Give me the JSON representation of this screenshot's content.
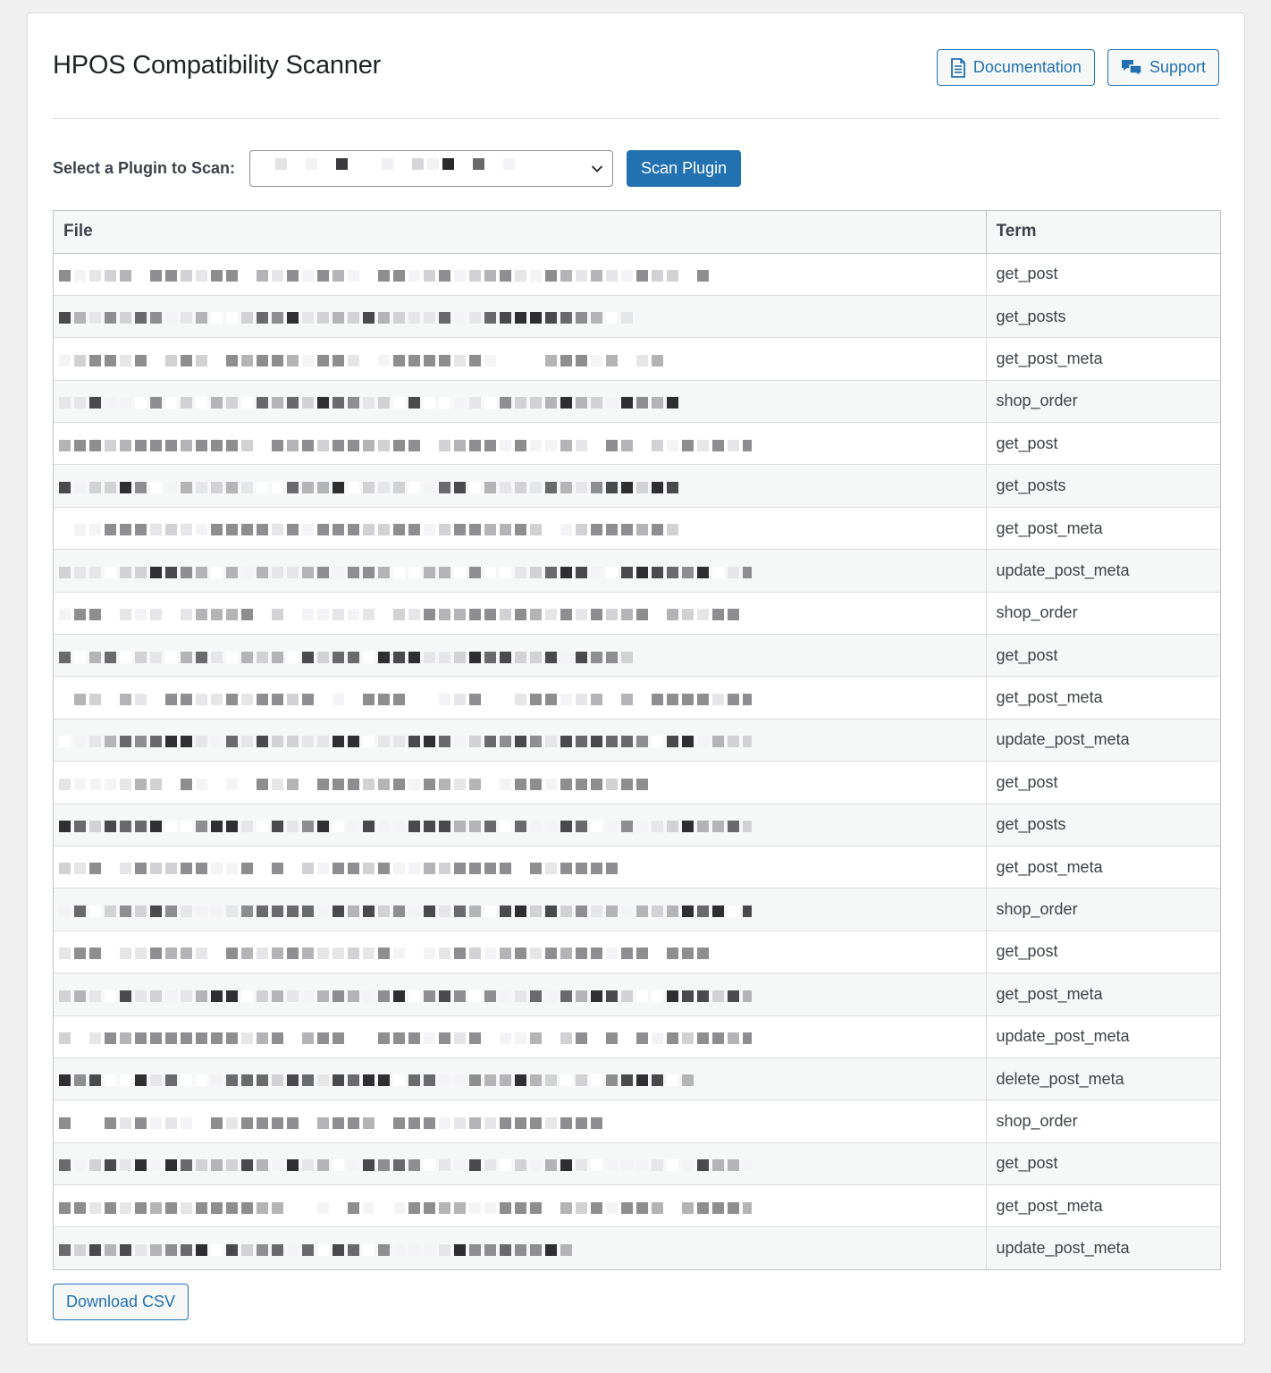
{
  "page": {
    "title": "HPOS Compatibility Scanner"
  },
  "header_buttons": {
    "documentation_label": "Documentation",
    "support_label": "Support"
  },
  "scan": {
    "label": "Select a Plugin to Scan:",
    "selected_plugin": "",
    "button_label": "Scan Plugin"
  },
  "table": {
    "columns": [
      "File",
      "Term"
    ],
    "rows": [
      {
        "file": "",
        "term": "get_post"
      },
      {
        "file": "",
        "term": "get_posts"
      },
      {
        "file": "",
        "term": "get_post_meta"
      },
      {
        "file": "",
        "term": "shop_order"
      },
      {
        "file": "",
        "term": "get_post"
      },
      {
        "file": "",
        "term": "get_posts"
      },
      {
        "file": "",
        "term": "get_post_meta"
      },
      {
        "file": "",
        "term": "update_post_meta"
      },
      {
        "file": "",
        "term": "shop_order"
      },
      {
        "file": "",
        "term": "get_post"
      },
      {
        "file": "",
        "term": "get_post_meta"
      },
      {
        "file": "",
        "term": "update_post_meta"
      },
      {
        "file": "",
        "term": "get_post"
      },
      {
        "file": "",
        "term": "get_posts"
      },
      {
        "file": "",
        "term": "get_post_meta"
      },
      {
        "file": "",
        "term": "shop_order"
      },
      {
        "file": "",
        "term": "get_post"
      },
      {
        "file": "",
        "term": "get_post_meta"
      },
      {
        "file": "",
        "term": "update_post_meta"
      },
      {
        "file": "",
        "term": "delete_post_meta"
      },
      {
        "file": "",
        "term": "shop_order"
      },
      {
        "file": "",
        "term": "get_post"
      },
      {
        "file": "",
        "term": "get_post_meta"
      },
      {
        "file": "",
        "term": "update_post_meta"
      }
    ]
  },
  "footer": {
    "download_label": "Download CSV"
  },
  "colors": {
    "accent": "#2271b1",
    "background": "#f0f0f1",
    "panel": "#ffffff",
    "text": "#1d2327",
    "row_alt": "#f6f7f7"
  },
  "icons": {
    "documentation": "document-icon",
    "support": "chat-bubbles-icon",
    "select": "chevron-down-icon"
  }
}
